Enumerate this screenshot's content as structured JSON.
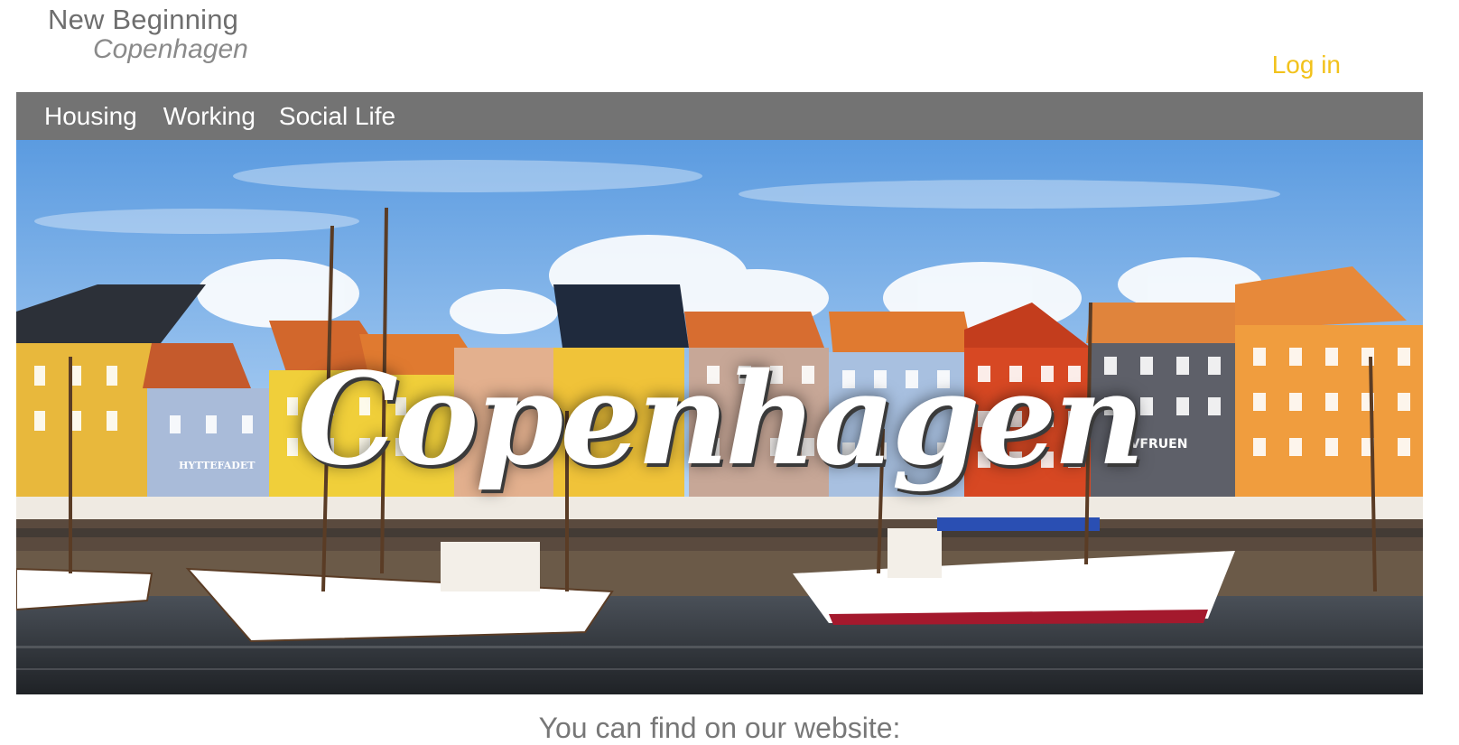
{
  "brand": {
    "title": "New Beginning",
    "subtitle": "Copenhagen"
  },
  "header": {
    "login_label": "Log in"
  },
  "nav": {
    "items": [
      {
        "label": "Housing"
      },
      {
        "label": "Working"
      },
      {
        "label": "Social Life"
      }
    ]
  },
  "hero": {
    "title": "Copenhagen",
    "sign_1": "HAVFRUEN",
    "sign_2": "HYTTEFADET"
  },
  "main": {
    "tagline": "You can find on our website:"
  },
  "colors": {
    "accent": "#f2c21b",
    "nav_bg": "#737373",
    "text_muted": "#777777"
  }
}
